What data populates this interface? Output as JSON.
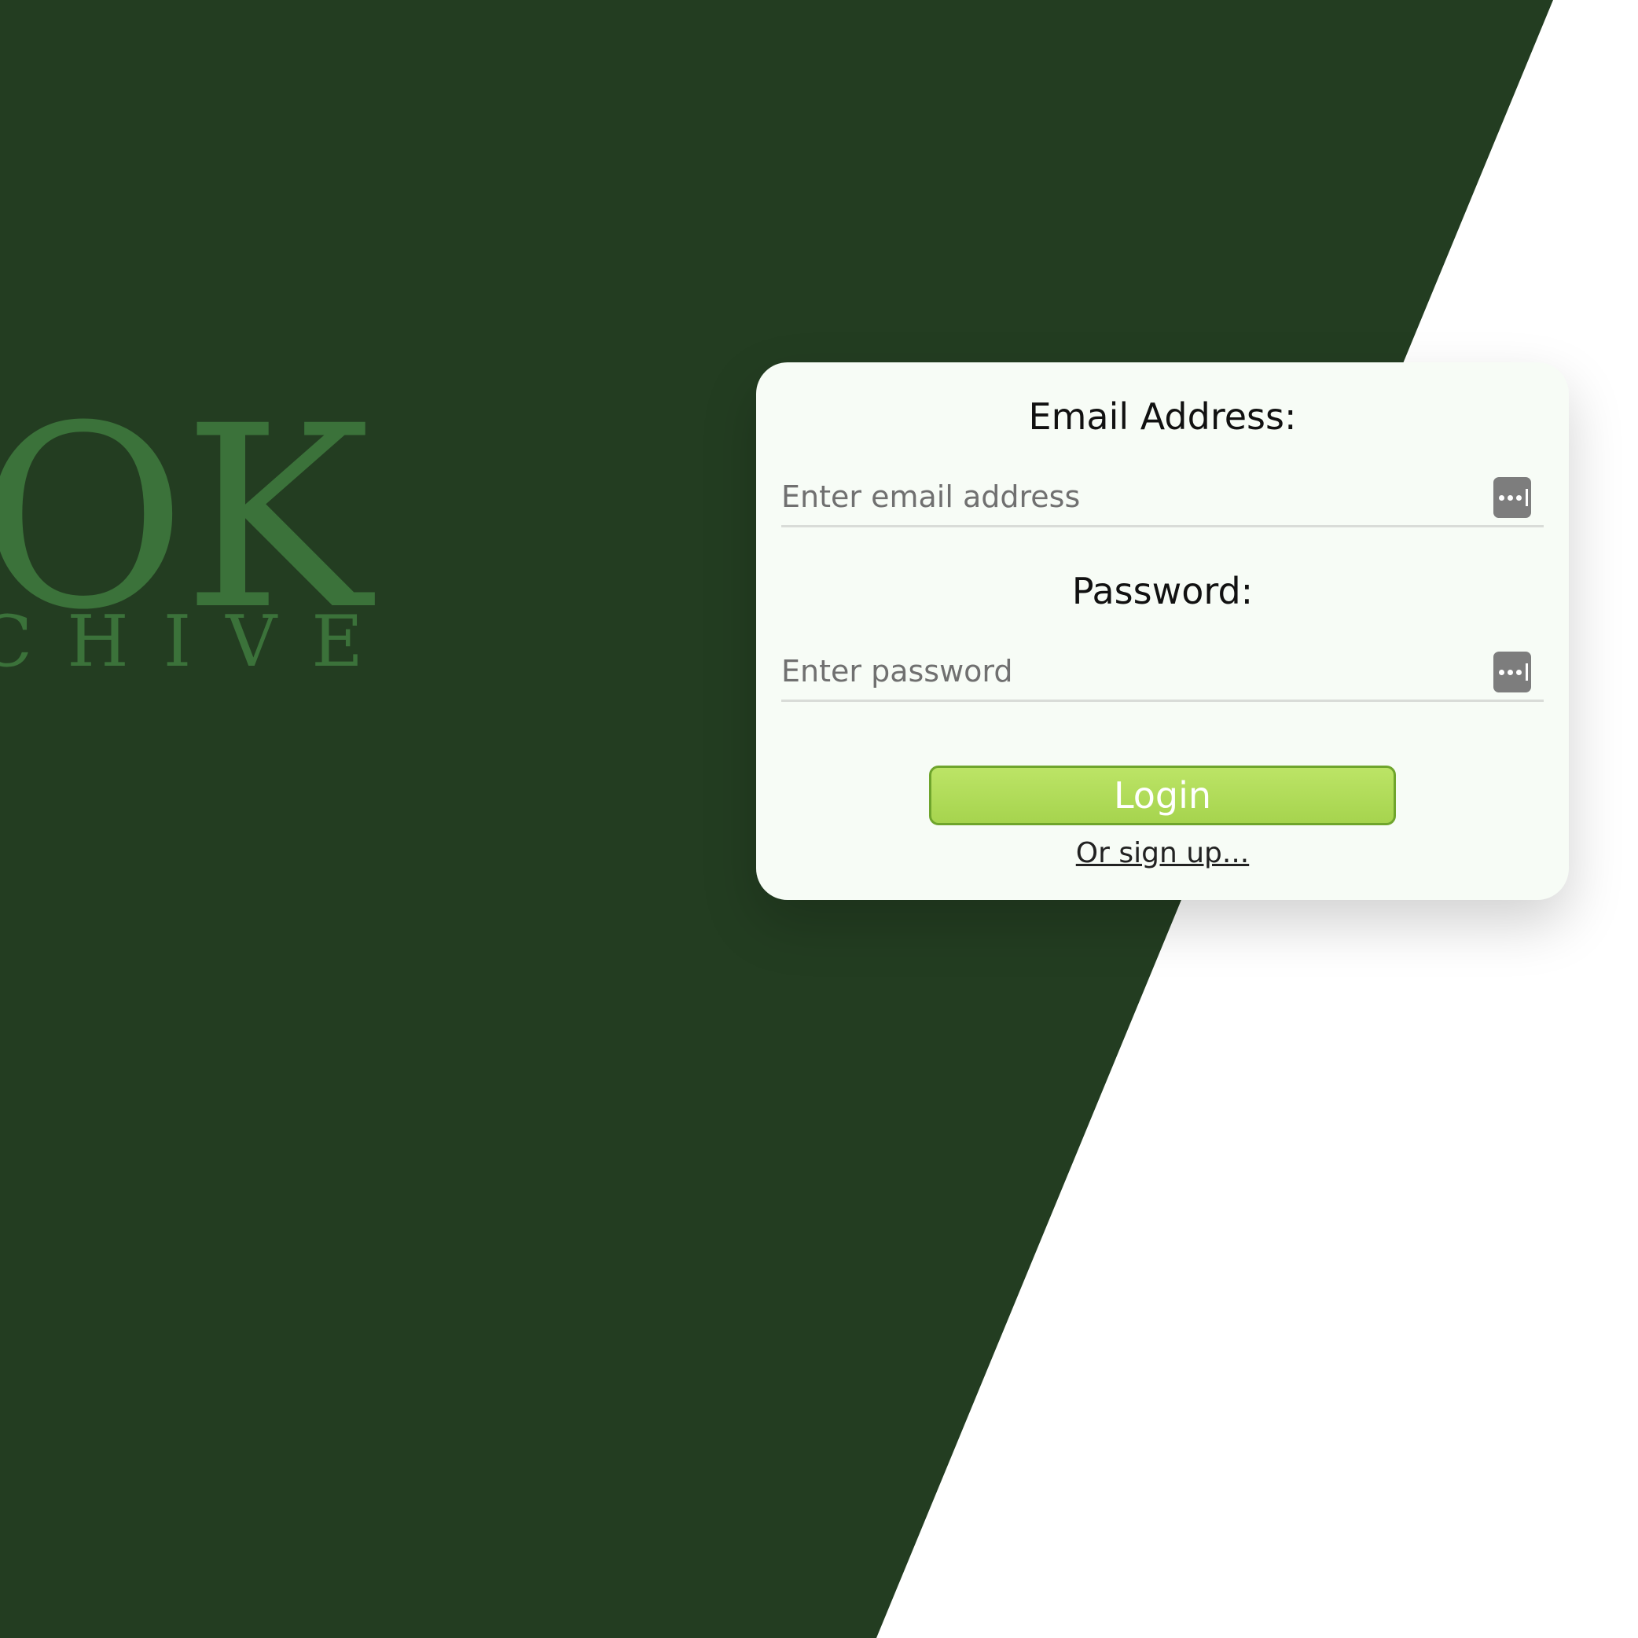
{
  "colors": {
    "background_dark_green": "#233d21",
    "background_white": "#ffffff",
    "logo_green": "#3b723a",
    "card_background": "#f7fcf6",
    "button_green": "#a6d44e"
  },
  "logo": {
    "main_text": "OOK",
    "sub_text": "CHIVE"
  },
  "login_form": {
    "email": {
      "label": "Email Address:",
      "placeholder": "Enter email address",
      "value": "",
      "icon": "password-manager-icon"
    },
    "password": {
      "label": "Password:",
      "placeholder": "Enter password",
      "value": "",
      "icon": "password-manager-icon"
    },
    "login_button_label": "Login",
    "signup_link_label": "Or sign up..."
  }
}
